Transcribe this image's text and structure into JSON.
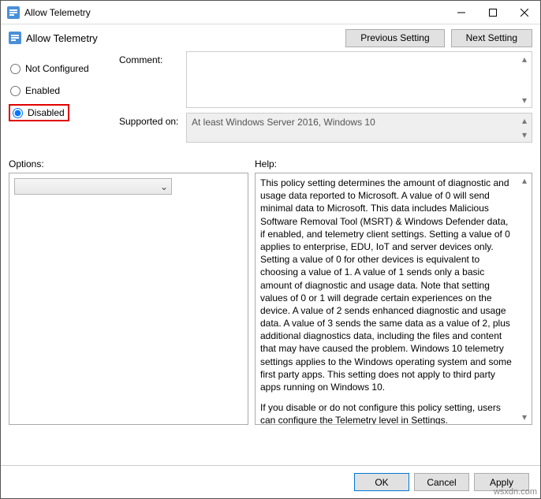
{
  "window": {
    "title": "Allow Telemetry"
  },
  "header": {
    "title": "Allow Telemetry",
    "prev": "Previous Setting",
    "next": "Next Setting"
  },
  "radios": {
    "not_configured": "Not Configured",
    "enabled": "Enabled",
    "disabled": "Disabled",
    "selected": "disabled"
  },
  "fields": {
    "comment_label": "Comment:",
    "comment_value": "",
    "supported_label": "Supported on:",
    "supported_value": "At least Windows Server 2016, Windows 10"
  },
  "sections": {
    "options": "Options:",
    "help": "Help:"
  },
  "help_text": {
    "p1": "This policy setting determines the amount of diagnostic and usage data reported to Microsoft. A value of 0 will send minimal data to Microsoft. This data includes Malicious Software Removal Tool (MSRT) & Windows Defender data, if enabled, and telemetry client settings. Setting a value of 0 applies to enterprise, EDU, IoT and server devices only. Setting a value of 0 for other devices is equivalent to choosing a value of 1. A value of 1 sends only a basic amount of diagnostic and usage data. Note that setting values of 0 or 1 will degrade certain experiences on the device. A value of 2 sends enhanced diagnostic and usage data. A value of 3 sends the same data as a value of 2, plus additional diagnostics data, including the files and content that may have caused the problem. Windows 10 telemetry settings applies to the Windows operating system and some first party apps. This setting does not apply to third party apps running on Windows 10.",
    "p2": "If you disable or do not configure this policy setting, users can configure the Telemetry level in Settings."
  },
  "buttons": {
    "ok": "OK",
    "cancel": "Cancel",
    "apply": "Apply"
  },
  "watermark": "wsxdn.com"
}
